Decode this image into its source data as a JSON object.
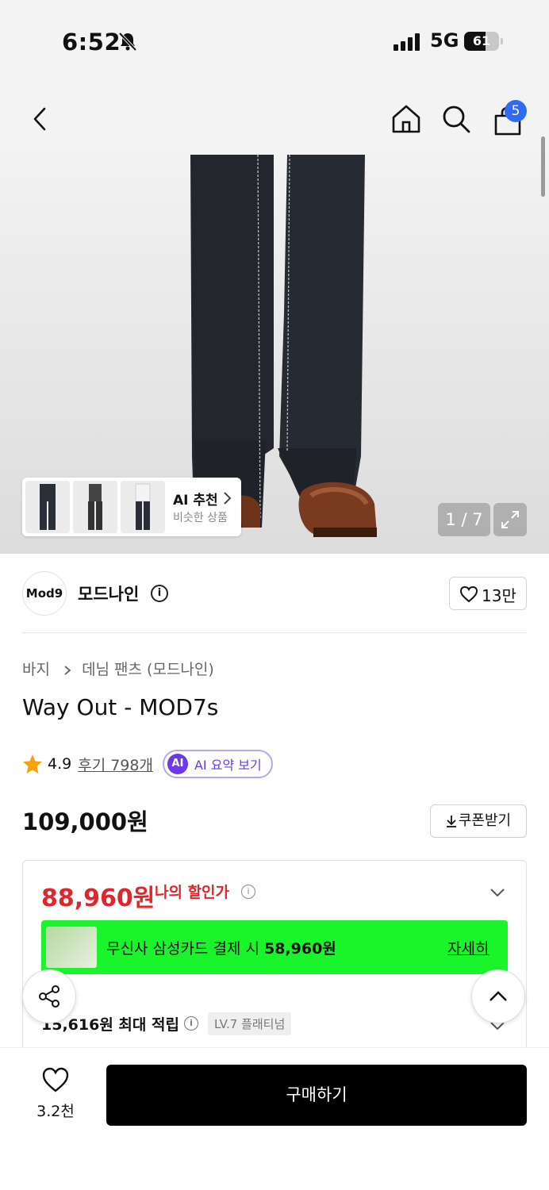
{
  "status": {
    "time": "6:52",
    "network": "5G",
    "battery": "61"
  },
  "nav": {
    "cart_count": "5"
  },
  "hero": {
    "pager": "1 / 7",
    "ai_card": {
      "title": "AI 추천",
      "subtitle": "비슷한 상품"
    }
  },
  "brand": {
    "logo_text": "Mod9",
    "name": "모드나인",
    "likes": "13만"
  },
  "breadcrumb": {
    "items": [
      "바지",
      "데님 팬츠 (모드나인)"
    ]
  },
  "product": {
    "title": "Way Out - MOD7s",
    "rating": "4.9",
    "review_text": "후기 798개",
    "ai_summary_label": "AI 요약 보기",
    "ai_icon_text": "AI",
    "price": "109,000원",
    "coupon_label": "쿠폰받기"
  },
  "discount": {
    "sale_price": "88,960원",
    "sale_label": "나의 할인가",
    "card_text_prefix": "무신사 삼성카드 결제 시 ",
    "card_text_price": "58,960원",
    "card_link": "자세히",
    "points_text": "15,616원 최대 적립",
    "level_badge": "LV.7 플래티넘"
  },
  "bottom": {
    "wish_count": "3.2천",
    "buy_label": "구매하기"
  },
  "colors": {
    "sale": "#e0262b",
    "card_banner": "#19f52a",
    "ai_accent": "#6d38e8",
    "badge": "#2f6bf2"
  }
}
